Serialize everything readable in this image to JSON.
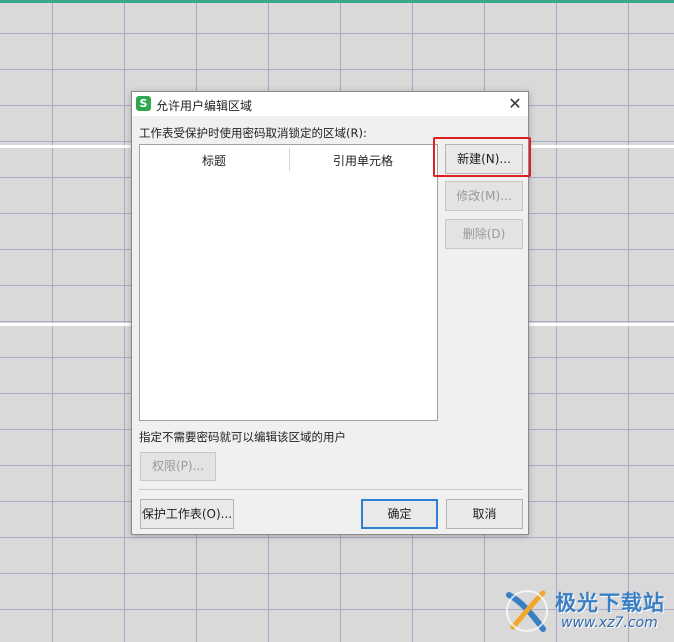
{
  "dialog": {
    "title": "允许用户编辑区域",
    "app_icon_letter": "S",
    "close_symbol": "✕",
    "ranges_label": "工作表受保护时使用密码取消锁定的区域(R):",
    "table": {
      "columns": [
        "标题",
        "引用单元格"
      ],
      "rows": []
    },
    "buttons": {
      "new": "新建(N)...",
      "modify": "修改(M)...",
      "delete": "删除(D)",
      "permissions": "权限(P)...",
      "protect_sheet": "保护工作表(O)...",
      "ok": "确定",
      "cancel": "取消"
    },
    "users_label": "指定不需要密码就可以编辑该区域的用户"
  },
  "watermark": {
    "site_title": "极光下载站",
    "url": "www.xz7.com"
  },
  "colors": {
    "highlight": "#e02020",
    "accent_green": "#3aa888",
    "default_button_border": "#2f7fd6"
  }
}
